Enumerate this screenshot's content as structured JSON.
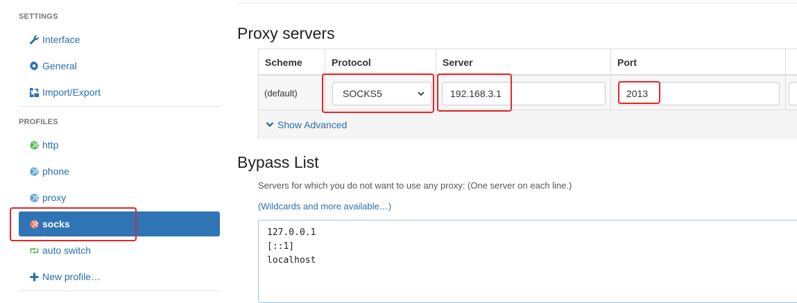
{
  "sidebar": {
    "settings_header": "SETTINGS",
    "settings_items": [
      {
        "label": "Interface",
        "icon": "wrench-icon"
      },
      {
        "label": "General",
        "icon": "gear-icon"
      },
      {
        "label": "Import/Export",
        "icon": "sitemap-icon"
      }
    ],
    "profiles_header": "PROFILES",
    "profile_items": [
      {
        "label": "http",
        "icon": "globe-icon",
        "color": "#5cb85c"
      },
      {
        "label": "phone",
        "icon": "globe-icon",
        "color": "#5ba4d8"
      },
      {
        "label": "proxy",
        "icon": "globe-icon",
        "color": "#5ba4d8"
      },
      {
        "label": "socks",
        "icon": "globe-icon",
        "color": "#e87b6a",
        "active": true
      },
      {
        "label": "auto switch",
        "icon": "retweet-icon",
        "color": "#5cb85c"
      },
      {
        "label": "New profile…",
        "icon": "plus-icon"
      }
    ]
  },
  "main": {
    "proxy_title": "Proxy servers",
    "table": {
      "headers": {
        "scheme": "Scheme",
        "protocol": "Protocol",
        "server": "Server",
        "port": "Port"
      },
      "row": {
        "scheme": "(default)",
        "protocol": "SOCKS5",
        "server": "192.168.3.1",
        "port": "2013"
      },
      "show_advanced": "Show Advanced"
    },
    "bypass_title": "Bypass List",
    "bypass_desc": "Servers for which you do not want to use any proxy: (One server on each line.)",
    "bypass_link": "(Wildcards and more available…)",
    "bypass_lines": [
      "127.0.0.1",
      "[::1]",
      "localhost"
    ]
  },
  "colors": {
    "accent": "#2f74b5",
    "link": "#2a6fb0",
    "annotation": "#e0252b"
  }
}
